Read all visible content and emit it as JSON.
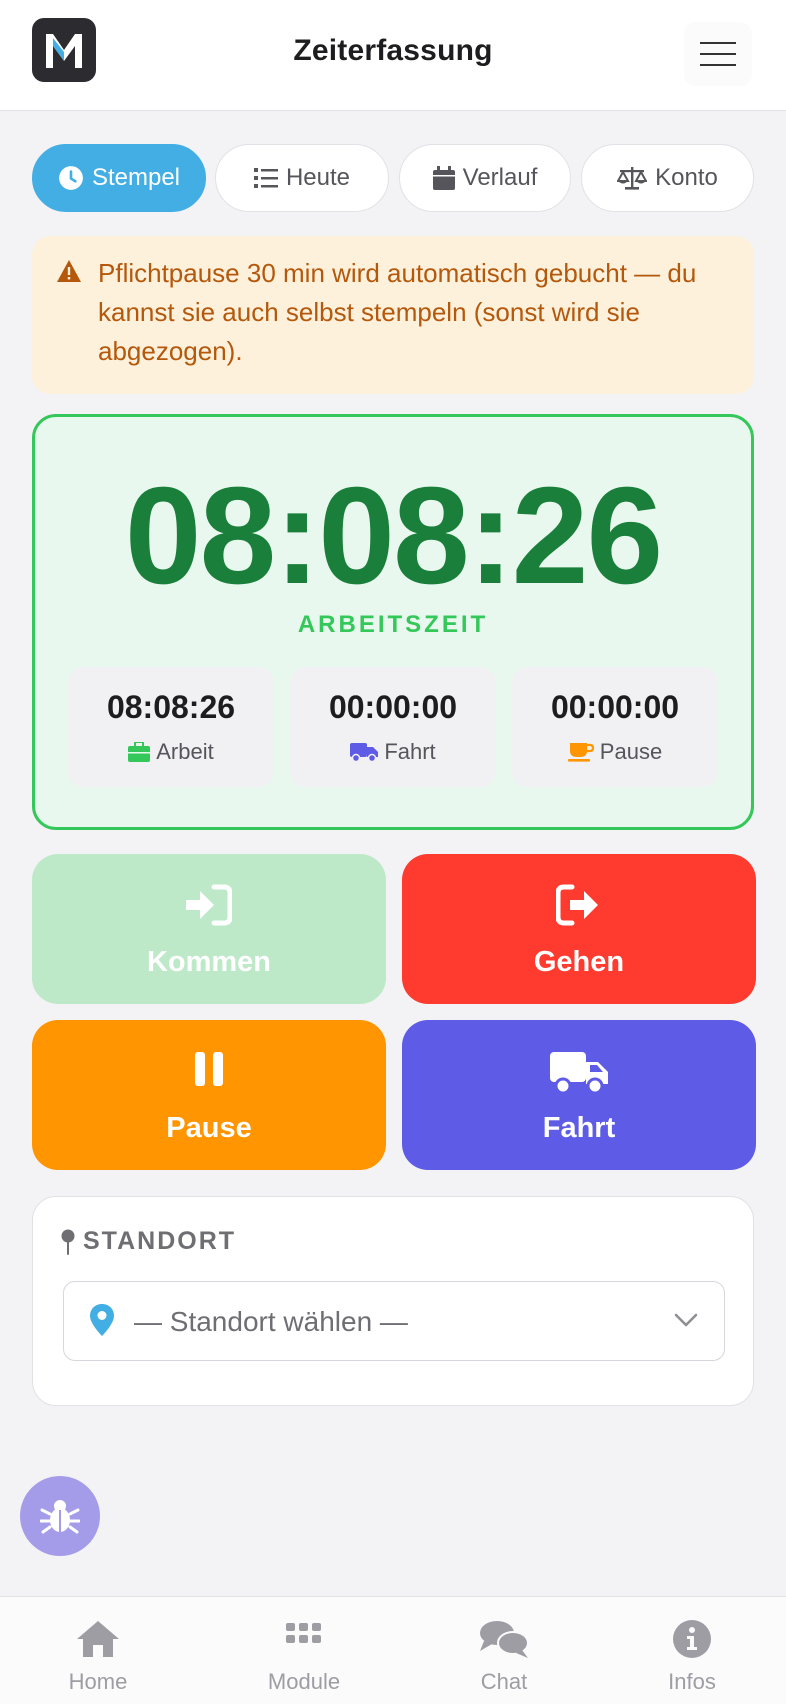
{
  "header": {
    "logo_letter": "M",
    "title": "Zeiterfassung",
    "menu_icon": "hamburger-menu-icon"
  },
  "tabs": [
    {
      "label": "Stempel",
      "icon": "clock-icon",
      "active": true
    },
    {
      "label": "Heute",
      "icon": "list-icon",
      "active": false
    },
    {
      "label": "Verlauf",
      "icon": "calendar-icon",
      "active": false
    },
    {
      "label": "Konto",
      "icon": "scale-icon",
      "active": false
    }
  ],
  "alert": {
    "icon": "warning-icon",
    "text": "Pflichtpause 30 min wird automatisch gebucht — du kannst sie auch selbst stempeln (sonst wird sie abgezogen)."
  },
  "timer": {
    "main_time": "08:08:26",
    "main_label": "ARBEITSZEIT",
    "breakdown": [
      {
        "time": "08:08:26",
        "label": "Arbeit",
        "icon": "briefcase-icon",
        "color": "#34c759"
      },
      {
        "time": "00:00:00",
        "label": "Fahrt",
        "icon": "truck-icon",
        "color": "#5e5ce6"
      },
      {
        "time": "00:00:00",
        "label": "Pause",
        "icon": "coffee-icon",
        "color": "#ff9500"
      }
    ]
  },
  "actions": [
    {
      "label": "Kommen",
      "icon": "sign-in-icon",
      "color": "#bde9c8",
      "enabled": false
    },
    {
      "label": "Gehen",
      "icon": "sign-out-icon",
      "color": "#ff3b30",
      "enabled": true
    },
    {
      "label": "Pause",
      "icon": "pause-icon",
      "color": "#ff9500",
      "enabled": true
    },
    {
      "label": "Fahrt",
      "icon": "truck-icon",
      "color": "#5e5ce6",
      "enabled": true
    }
  ],
  "standort": {
    "title": "STANDORT",
    "title_icon": "map-pin-icon",
    "selected": "— Standort wählen —"
  },
  "debug": {
    "icon": "bug-icon"
  },
  "bottom_nav": [
    {
      "label": "Home",
      "icon": "home-icon"
    },
    {
      "label": "Module",
      "icon": "grid-icon"
    },
    {
      "label": "Chat",
      "icon": "chat-icon"
    },
    {
      "label": "Infos",
      "icon": "info-icon"
    }
  ],
  "colors": {
    "accent": "#43aee4",
    "success": "#34c759",
    "success_dark": "#1a7f3a",
    "danger": "#ff3b30",
    "warning": "#ff9500",
    "indigo": "#5e5ce6"
  }
}
